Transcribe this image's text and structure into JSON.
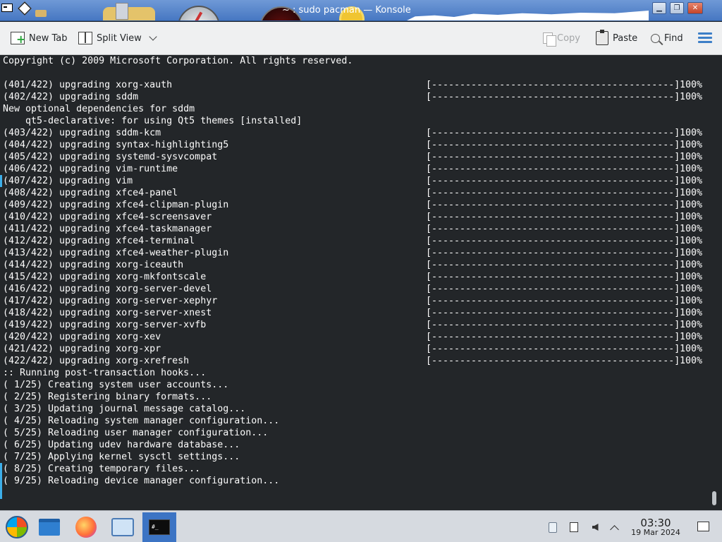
{
  "window": {
    "title": "~ : sudo pacman — Konsole"
  },
  "toolbar": {
    "new_tab": "New Tab",
    "split_view": "Split View",
    "copy": "Copy",
    "paste": "Paste",
    "find": "Find"
  },
  "terminal": {
    "copyright": "Copyright (c) 2009 Microsoft Corporation. All rights reserved.",
    "progress_bar": "[-------------------------------------------]",
    "upgrades_a": [
      {
        "label": "(401/422) upgrading xorg-xauth",
        "percent": "100%"
      },
      {
        "label": "(402/422) upgrading sddm",
        "percent": "100%"
      }
    ],
    "deps_header": "New optional dependencies for sddm",
    "deps_item": "    qt5-declarative: for using Qt5 themes [installed]",
    "upgrades_b": [
      {
        "label": "(403/422) upgrading sddm-kcm",
        "percent": "100%"
      },
      {
        "label": "(404/422) upgrading syntax-highlighting5",
        "percent": "100%"
      },
      {
        "label": "(405/422) upgrading systemd-sysvcompat",
        "percent": "100%"
      },
      {
        "label": "(406/422) upgrading vim-runtime",
        "percent": "100%"
      },
      {
        "label": "(407/422) upgrading vim",
        "percent": "100%"
      },
      {
        "label": "(408/422) upgrading xfce4-panel",
        "percent": "100%"
      },
      {
        "label": "(409/422) upgrading xfce4-clipman-plugin",
        "percent": "100%"
      },
      {
        "label": "(410/422) upgrading xfce4-screensaver",
        "percent": "100%"
      },
      {
        "label": "(411/422) upgrading xfce4-taskmanager",
        "percent": "100%"
      },
      {
        "label": "(412/422) upgrading xfce4-terminal",
        "percent": "100%"
      },
      {
        "label": "(413/422) upgrading xfce4-weather-plugin",
        "percent": "100%"
      },
      {
        "label": "(414/422) upgrading xorg-iceauth",
        "percent": "100%"
      },
      {
        "label": "(415/422) upgrading xorg-mkfontscale",
        "percent": "100%"
      },
      {
        "label": "(416/422) upgrading xorg-server-devel",
        "percent": "100%"
      },
      {
        "label": "(417/422) upgrading xorg-server-xephyr",
        "percent": "100%"
      },
      {
        "label": "(418/422) upgrading xorg-server-xnest",
        "percent": "100%"
      },
      {
        "label": "(419/422) upgrading xorg-server-xvfb",
        "percent": "100%"
      },
      {
        "label": "(420/422) upgrading xorg-xev",
        "percent": "100%"
      },
      {
        "label": "(421/422) upgrading xorg-xpr",
        "percent": "100%"
      },
      {
        "label": "(422/422) upgrading xorg-xrefresh",
        "percent": "100%"
      }
    ],
    "hooks_header": ":: Running post-transaction hooks...",
    "hooks": [
      "( 1/25) Creating system user accounts...",
      "( 2/25) Registering binary formats...",
      "( 3/25) Updating journal message catalog...",
      "( 4/25) Reloading system manager configuration...",
      "( 5/25) Reloading user manager configuration...",
      "( 6/25) Updating udev hardware database...",
      "( 7/25) Applying kernel sysctl settings...",
      "( 8/25) Creating temporary files...",
      "( 9/25) Reloading device manager configuration..."
    ]
  },
  "taskbar": {
    "items": [
      "start-orb",
      "file-manager",
      "firefox",
      "system-settings",
      "konsole"
    ],
    "active": "konsole",
    "konsole_glyph": "#_",
    "tray": [
      "clipboard-icon",
      "notes-icon",
      "volume-muted-icon",
      "tray-expand-icon"
    ],
    "clock_time": "03:30",
    "clock_date": "19 Mar 2024"
  },
  "colors": {
    "terminal_bg": "#232629",
    "terminal_fg": "#fcfcfc",
    "titlebar": "#4677c2",
    "accent": "#3daee9",
    "taskbar": "#d6dae0"
  }
}
